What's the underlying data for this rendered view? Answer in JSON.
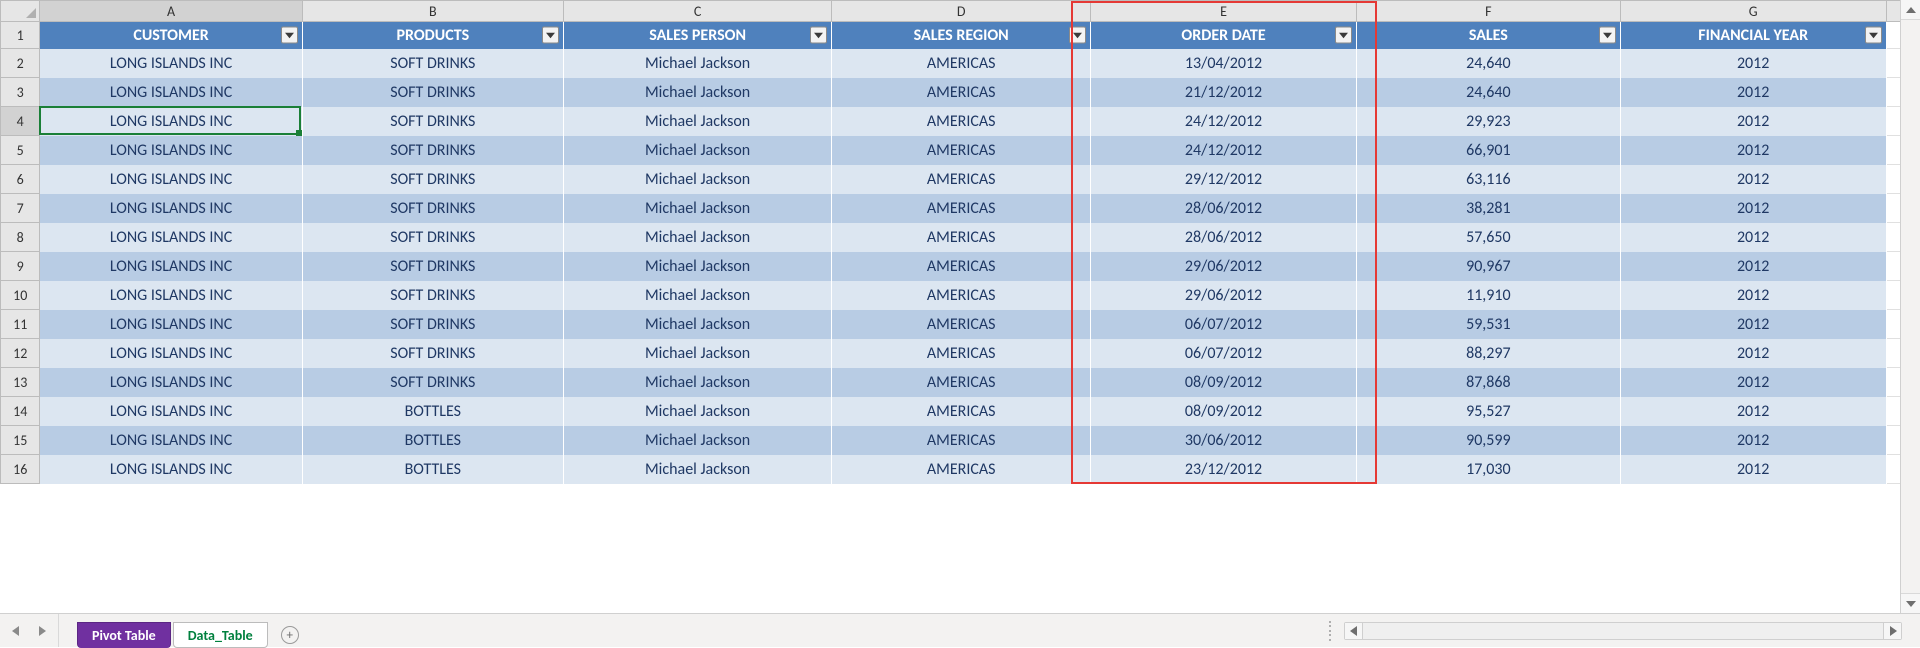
{
  "columns_letters": [
    "A",
    "B",
    "C",
    "D",
    "E",
    "F",
    "G"
  ],
  "headers": [
    "CUSTOMER",
    "PRODUCTS",
    "SALES PERSON",
    "SALES REGION",
    "ORDER DATE",
    "SALES",
    "FINANCIAL YEAR"
  ],
  "rows": [
    {
      "n": 2,
      "customer": "LONG ISLANDS INC",
      "product": "SOFT DRINKS",
      "person": "Michael Jackson",
      "region": "AMERICAS",
      "date": "13/04/2012",
      "sales": "24,640",
      "fy": "2012"
    },
    {
      "n": 3,
      "customer": "LONG ISLANDS INC",
      "product": "SOFT DRINKS",
      "person": "Michael Jackson",
      "region": "AMERICAS",
      "date": "21/12/2012",
      "sales": "24,640",
      "fy": "2012"
    },
    {
      "n": 4,
      "customer": "LONG ISLANDS INC",
      "product": "SOFT DRINKS",
      "person": "Michael Jackson",
      "region": "AMERICAS",
      "date": "24/12/2012",
      "sales": "29,923",
      "fy": "2012"
    },
    {
      "n": 5,
      "customer": "LONG ISLANDS INC",
      "product": "SOFT DRINKS",
      "person": "Michael Jackson",
      "region": "AMERICAS",
      "date": "24/12/2012",
      "sales": "66,901",
      "fy": "2012"
    },
    {
      "n": 6,
      "customer": "LONG ISLANDS INC",
      "product": "SOFT DRINKS",
      "person": "Michael Jackson",
      "region": "AMERICAS",
      "date": "29/12/2012",
      "sales": "63,116",
      "fy": "2012"
    },
    {
      "n": 7,
      "customer": "LONG ISLANDS INC",
      "product": "SOFT DRINKS",
      "person": "Michael Jackson",
      "region": "AMERICAS",
      "date": "28/06/2012",
      "sales": "38,281",
      "fy": "2012"
    },
    {
      "n": 8,
      "customer": "LONG ISLANDS INC",
      "product": "SOFT DRINKS",
      "person": "Michael Jackson",
      "region": "AMERICAS",
      "date": "28/06/2012",
      "sales": "57,650",
      "fy": "2012"
    },
    {
      "n": 9,
      "customer": "LONG ISLANDS INC",
      "product": "SOFT DRINKS",
      "person": "Michael Jackson",
      "region": "AMERICAS",
      "date": "29/06/2012",
      "sales": "90,967",
      "fy": "2012"
    },
    {
      "n": 10,
      "customer": "LONG ISLANDS INC",
      "product": "SOFT DRINKS",
      "person": "Michael Jackson",
      "region": "AMERICAS",
      "date": "29/06/2012",
      "sales": "11,910",
      "fy": "2012"
    },
    {
      "n": 11,
      "customer": "LONG ISLANDS INC",
      "product": "SOFT DRINKS",
      "person": "Michael Jackson",
      "region": "AMERICAS",
      "date": "06/07/2012",
      "sales": "59,531",
      "fy": "2012"
    },
    {
      "n": 12,
      "customer": "LONG ISLANDS INC",
      "product": "SOFT DRINKS",
      "person": "Michael Jackson",
      "region": "AMERICAS",
      "date": "06/07/2012",
      "sales": "88,297",
      "fy": "2012"
    },
    {
      "n": 13,
      "customer": "LONG ISLANDS INC",
      "product": "SOFT DRINKS",
      "person": "Michael Jackson",
      "region": "AMERICAS",
      "date": "08/09/2012",
      "sales": "87,868",
      "fy": "2012"
    },
    {
      "n": 14,
      "customer": "LONG ISLANDS INC",
      "product": "BOTTLES",
      "person": "Michael Jackson",
      "region": "AMERICAS",
      "date": "08/09/2012",
      "sales": "95,527",
      "fy": "2012"
    },
    {
      "n": 15,
      "customer": "LONG ISLANDS INC",
      "product": "BOTTLES",
      "person": "Michael Jackson",
      "region": "AMERICAS",
      "date": "30/06/2012",
      "sales": "90,599",
      "fy": "2012"
    },
    {
      "n": 16,
      "customer": "LONG ISLANDS INC",
      "product": "BOTTLES",
      "person": "Michael Jackson",
      "region": "AMERICAS",
      "date": "23/12/2012",
      "sales": "17,030",
      "fy": "2012"
    }
  ],
  "selected_cell": {
    "row": 4,
    "col": "A"
  },
  "highlight_col": "E",
  "tabs": {
    "pivot": "Pivot Table",
    "data": "Data_Table"
  },
  "colors": {
    "header_bg": "#4f81bd",
    "band0": "#dce6f1",
    "band1": "#b8cce4",
    "sel_green": "#1a7f37",
    "highlight_red": "#e53935",
    "tab_purple": "#7030a0",
    "tab_green_text": "#00803e"
  }
}
